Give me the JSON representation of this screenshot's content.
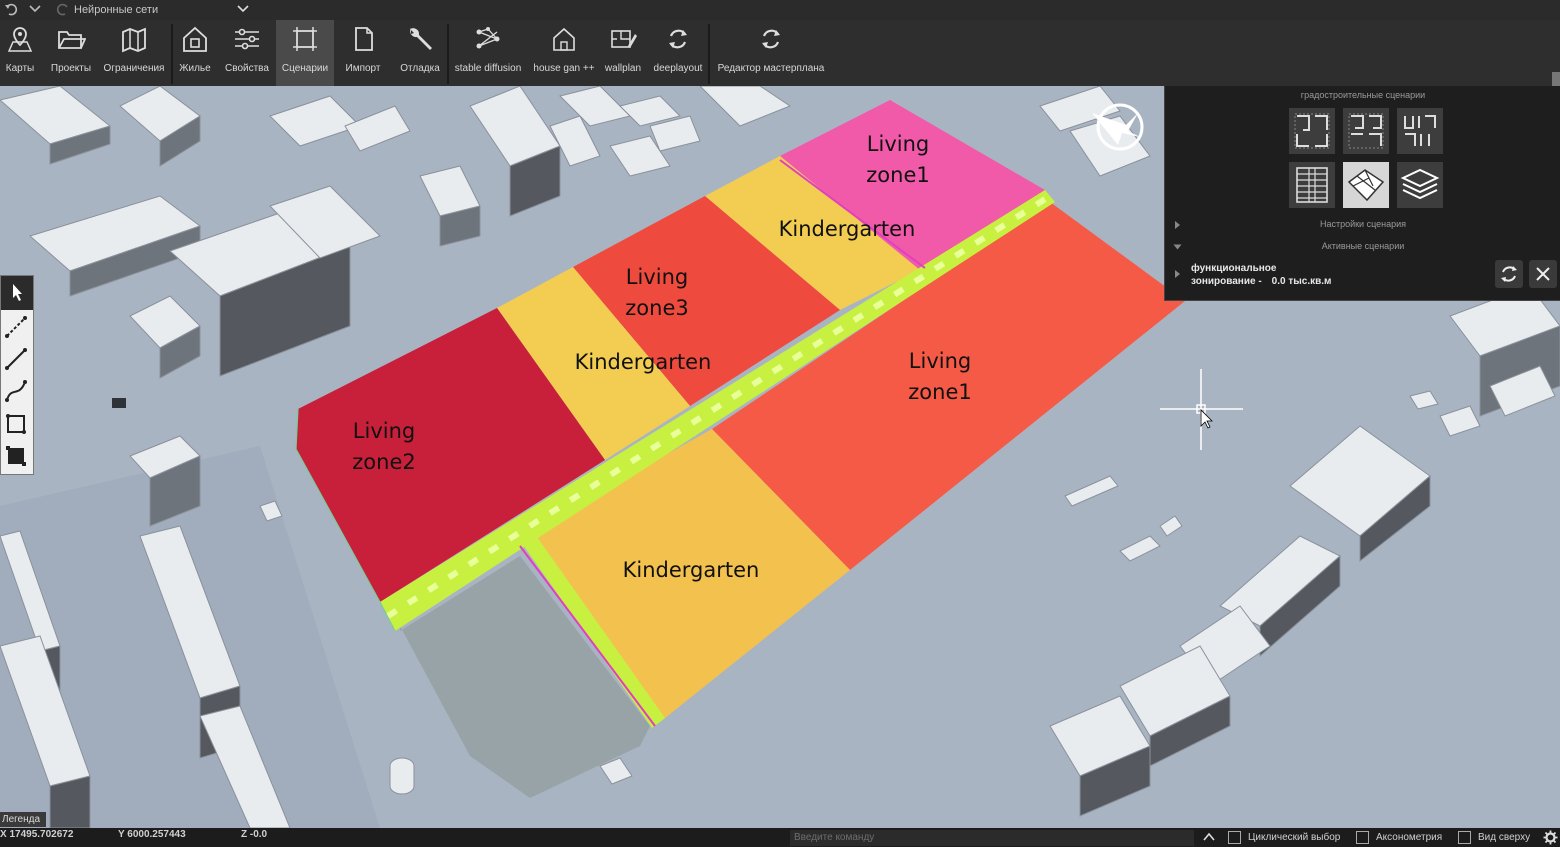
{
  "window": {
    "title": "Нейронные сети"
  },
  "toolbar": {
    "items": [
      {
        "label": "Карты",
        "icon": "map-pin-icon"
      },
      {
        "label": "Проекты",
        "icon": "folder-open-icon"
      },
      {
        "label": "Ограничения",
        "icon": "map-restriction-icon"
      },
      {
        "label": "Жилье",
        "icon": "house-icon"
      },
      {
        "label": "Свойства",
        "icon": "sliders-icon"
      },
      {
        "label": "Сценарии",
        "icon": "scenario-frame-icon"
      },
      {
        "label": "Импорт",
        "icon": "file-icon"
      },
      {
        "label": "Отладка",
        "icon": "wrench-icon"
      },
      {
        "label": "stable diffusion",
        "icon": "network-icon"
      },
      {
        "label": "house gan ++",
        "icon": "house-outline-icon"
      },
      {
        "label": "wallplan",
        "icon": "wallplan-icon"
      },
      {
        "label": "deeplayout",
        "icon": "refresh-icon"
      },
      {
        "label": "Редактор мастерплана",
        "icon": "refresh-icon"
      }
    ],
    "active": "Сценарии"
  },
  "zones": [
    {
      "line1": "Living",
      "line2": "zone1",
      "color": "#f05aa8"
    },
    {
      "line1": "Kindergarten",
      "line2": "",
      "color": "#f2cd52"
    },
    {
      "line1": "Living",
      "line2": "zone3",
      "color": "#ef4a3e"
    },
    {
      "line1": "Kindergarten",
      "line2": "",
      "color": "#f2cd52"
    },
    {
      "line1": "Living",
      "line2": "zone1",
      "color": "#f55a46"
    },
    {
      "line1": "Living",
      "line2": "zone2",
      "color": "#c8203a"
    },
    {
      "line1": "Kindergarten",
      "line2": "",
      "color": "#f3c14e"
    }
  ],
  "scenario_panel": {
    "heading": "градостроительные сценарии",
    "settings_label": "Настройки сценария",
    "active_label": "Активные сценарии",
    "active_item_line1": "функциональное",
    "active_item_line2": "зонирование -",
    "active_item_value": "0.0 тыс.кв.м"
  },
  "legend": {
    "label": "Легенда"
  },
  "status": {
    "x": "X 17495.702672",
    "y": "Y 6000.257443",
    "z": "Z -0.0",
    "command_placeholder": "Введите команду",
    "cyclic_select": "Циклический выбор",
    "axonometry": "Аксонометрия",
    "top_view": "Вид сверху"
  },
  "colors": {
    "road": "#c8f040",
    "ground": "#a9b4c3",
    "toolbar": "#2e2e2e",
    "empty_lot": "#97a3a7"
  }
}
